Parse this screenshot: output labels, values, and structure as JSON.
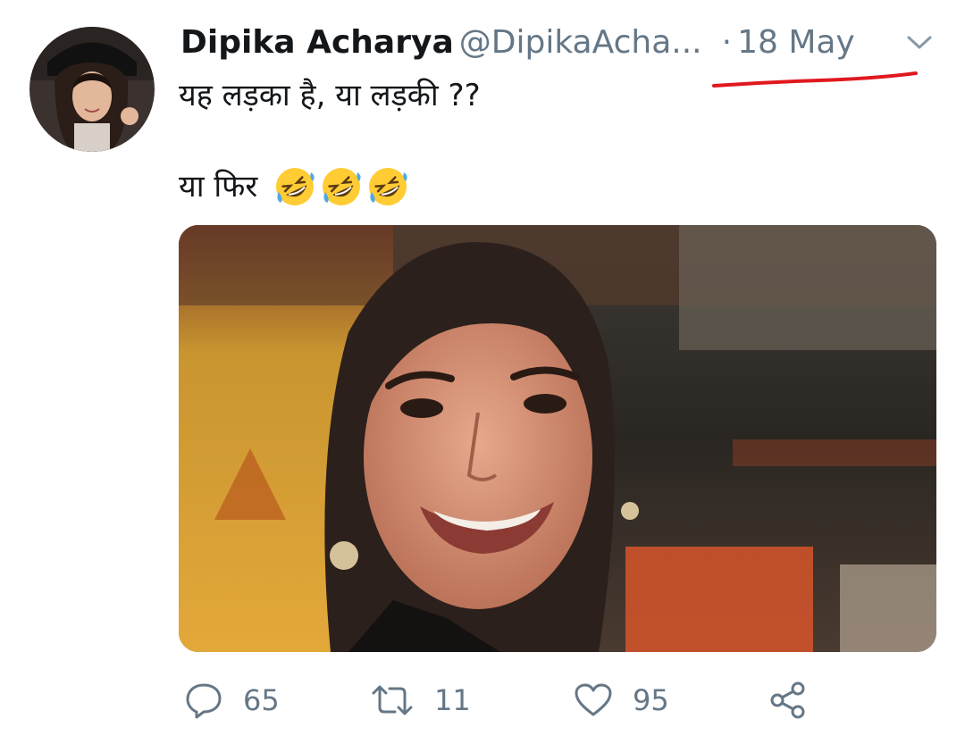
{
  "tweet": {
    "display_name": "Dipika Acharya",
    "handle": "@DipikaAcha...",
    "separator": "·",
    "date": "18 May",
    "text_line_1": "यह लड़का है, या लड़की ??",
    "text_line_2": "या फिर",
    "emoji": [
      "rolling-on-floor-laughing",
      "rolling-on-floor-laughing",
      "rolling-on-floor-laughing"
    ]
  },
  "actions": {
    "reply_count": "65",
    "retweet_count": "11",
    "like_count": "95"
  },
  "colors": {
    "text_primary": "#14171a",
    "text_secondary": "#657786",
    "annotation_red": "#e0191f"
  },
  "icons": {
    "menu": "chevron-down-icon",
    "reply": "reply-icon",
    "retweet": "retweet-icon",
    "like": "heart-icon",
    "share": "share-icon"
  }
}
